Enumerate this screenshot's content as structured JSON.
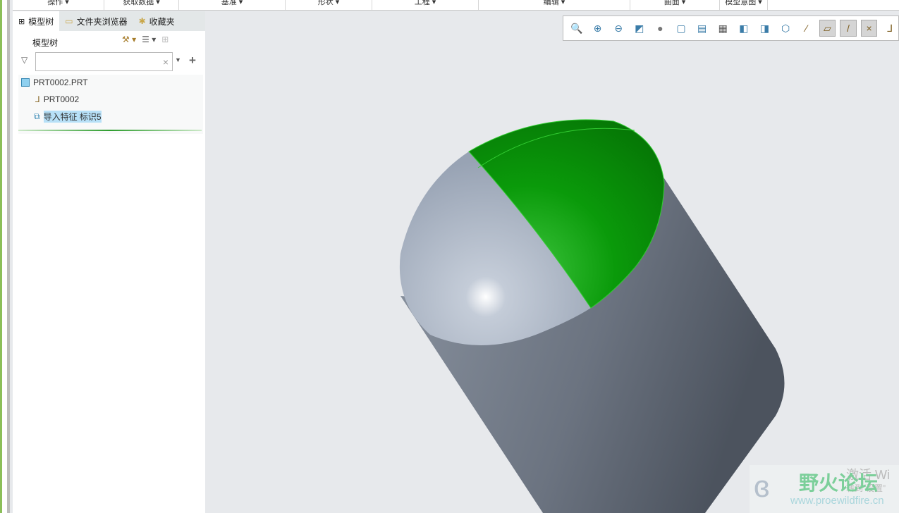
{
  "menus": [
    "操作 ▾",
    "获取数据 ▾",
    "基准 ▾",
    "形状 ▾",
    "工程 ▾",
    "编辑 ▾",
    "曲面 ▾",
    "模型意图 ▾"
  ],
  "tabs": [
    {
      "label": "模型树",
      "icon": "tree-icon"
    },
    {
      "label": "文件夹浏览器",
      "icon": "folder-icon"
    },
    {
      "label": "收藏夹",
      "icon": "favorites-icon"
    }
  ],
  "panel": {
    "title": "模型树",
    "filter_value": "",
    "clear": "×",
    "add": "+"
  },
  "tree": [
    {
      "label": "PRT0002.PRT",
      "icon": "part-icon"
    },
    {
      "label": "PRT0002",
      "icon": "csys-icon"
    },
    {
      "label": "导入特征 标识5",
      "icon": "import-feature-icon"
    }
  ],
  "view_toolbar": [
    "refit",
    "zoom-in",
    "zoom-out",
    "repaint",
    "display-style",
    "saved-orientations",
    "named-views",
    "view-manager",
    "spin-center",
    "perspective",
    "section",
    "datum-display",
    "plane-display",
    "axis-display",
    "point-display",
    "csys-display"
  ],
  "watermark": {
    "title": "野火论坛",
    "url": "www.proewildfire.cn",
    "activate": "激活 Wi",
    "activate2": "转到“设置”"
  },
  "colors": {
    "green": "#0a9a0a",
    "body": "#6f7886"
  }
}
